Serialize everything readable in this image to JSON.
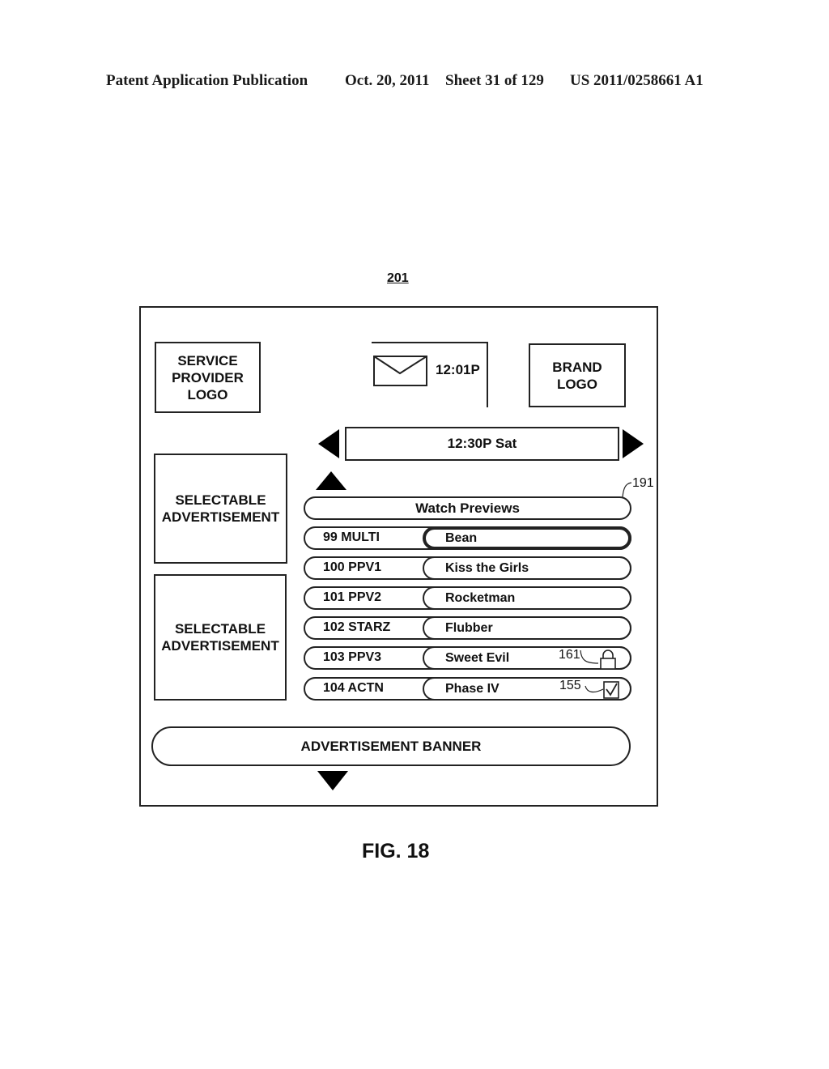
{
  "header": {
    "publication": "Patent Application Publication",
    "date": "Oct. 20, 2011",
    "sheet": "Sheet 31 of 129",
    "number": "US 2011/0258661 A1"
  },
  "figure": {
    "reference": "201",
    "caption": "FIG. 18"
  },
  "screen": {
    "service_provider_logo": [
      "SERVICE",
      "PROVIDER",
      "LOGO"
    ],
    "brand_logo": [
      "BRAND",
      "LOGO"
    ],
    "mail_icon": "envelope-icon",
    "clock": "12:01P",
    "time_slot": "12:30P Sat",
    "nav_icons": {
      "left": "triangle-left-icon",
      "right": "triangle-right-icon",
      "up": "triangle-up-icon",
      "down": "triangle-down-icon"
    },
    "ads": [
      [
        "SELECTABLE",
        "ADVERTISEMENT"
      ],
      [
        "SELECTABLE",
        "ADVERTISEMENT"
      ]
    ],
    "watch_previews": "Watch Previews",
    "watch_previews_ref": "191",
    "listings": [
      {
        "channel": "99 MULTI",
        "program": "Bean",
        "selected": true
      },
      {
        "channel": "100 PPV1",
        "program": "Kiss the Girls"
      },
      {
        "channel": "101 PPV2",
        "program": "Rocketman"
      },
      {
        "channel": "102 STARZ",
        "program": "Flubber"
      },
      {
        "channel": "103 PPV3",
        "program": "Sweet Evil",
        "icon": "lock-icon",
        "ref": "161"
      },
      {
        "channel": "104 ACTN",
        "program": "Phase IV",
        "icon": "checkbox-checked-icon",
        "ref": "155"
      }
    ],
    "banner": "ADVERTISEMENT BANNER"
  }
}
